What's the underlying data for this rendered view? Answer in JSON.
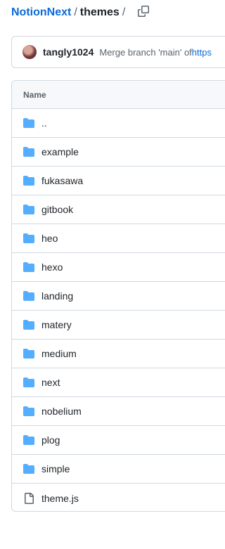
{
  "breadcrumb": {
    "repo": "NotionNext",
    "separator": "/",
    "current": "themes",
    "trailing_separator": "/"
  },
  "commit": {
    "author": "tangly1024",
    "message": "Merge branch 'main' of ",
    "link_text": "https"
  },
  "table": {
    "header_name": "Name",
    "rows": [
      {
        "name": "..",
        "type": "folder"
      },
      {
        "name": "example",
        "type": "folder"
      },
      {
        "name": "fukasawa",
        "type": "folder"
      },
      {
        "name": "gitbook",
        "type": "folder"
      },
      {
        "name": "heo",
        "type": "folder"
      },
      {
        "name": "hexo",
        "type": "folder"
      },
      {
        "name": "landing",
        "type": "folder"
      },
      {
        "name": "matery",
        "type": "folder"
      },
      {
        "name": "medium",
        "type": "folder"
      },
      {
        "name": "next",
        "type": "folder"
      },
      {
        "name": "nobelium",
        "type": "folder"
      },
      {
        "name": "plog",
        "type": "folder"
      },
      {
        "name": "simple",
        "type": "folder"
      },
      {
        "name": "theme.js",
        "type": "file"
      }
    ]
  },
  "icons": {
    "folder": "folder-icon",
    "file": "file-icon",
    "copy": "copy-icon"
  },
  "colors": {
    "link": "#0969da",
    "folder": "#54aeff",
    "file": "#59636e",
    "border": "#d1d9e0",
    "header_bg": "#f6f8fa"
  }
}
